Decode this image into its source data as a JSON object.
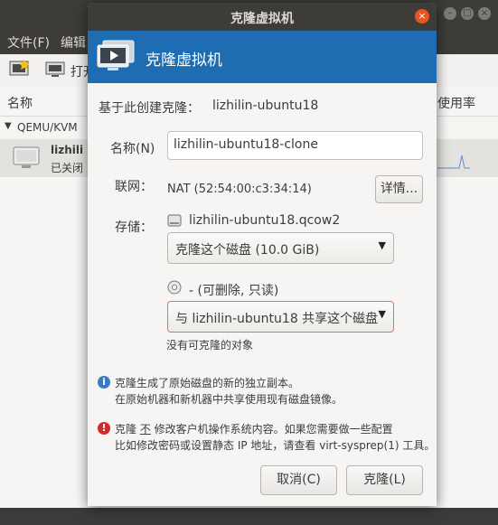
{
  "background_window": {
    "menu": {
      "file": "文件(F)",
      "edit": "编辑"
    },
    "toolbar": {
      "open_label": "打开"
    },
    "columns": {
      "name": "名称",
      "usage": "使用率"
    },
    "group": {
      "label": "QEMU/KVM"
    },
    "vm_row": {
      "name": "lizhili",
      "status": "已关闭"
    }
  },
  "dialog": {
    "title": "克隆虚拟机",
    "banner_title": "克隆虚拟机",
    "create_from_label": "基于此创建克隆：",
    "create_from_value": "lizhilin-ubuntu18",
    "name_label": "名称(N)",
    "name_value": "lizhilin-ubuntu18-clone",
    "network_label": "联网：",
    "network_value": "NAT (52:54:00:c3:34:14)",
    "details_button": "详情...",
    "storage_label": "存储：",
    "disk1": {
      "file": "lizhilin-ubuntu18.qcow2",
      "selected_option": "克隆这个磁盘 (10.0 GiB)"
    },
    "disk2": {
      "file": "- (可删除, 只读)",
      "selected_option": "与 lizhilin-ubuntu18 共享这个磁盘",
      "note": "没有可克隆的对象"
    },
    "info_text_1": "克隆生成了原始磁盘的新的独立副本。",
    "info_text_2": "在原始机器和新机器中共享使用现有磁盘镜像。",
    "warn_pre": "克隆",
    "warn_not": "不",
    "warn_post": " 修改客户机操作系统内容。如果您需要做一些配置",
    "warn_text_2": "比如修改密码或设置静态 IP 地址，请查看 virt-sysprep(1) 工具。",
    "cancel_button": "取消(C)",
    "clone_button": "克隆(L)",
    "colors": {
      "banner": "#1e6db2",
      "close": "#e95420",
      "warn": "#d12a2a",
      "info": "#3a7bc8",
      "error_border": "#e0754f"
    }
  }
}
